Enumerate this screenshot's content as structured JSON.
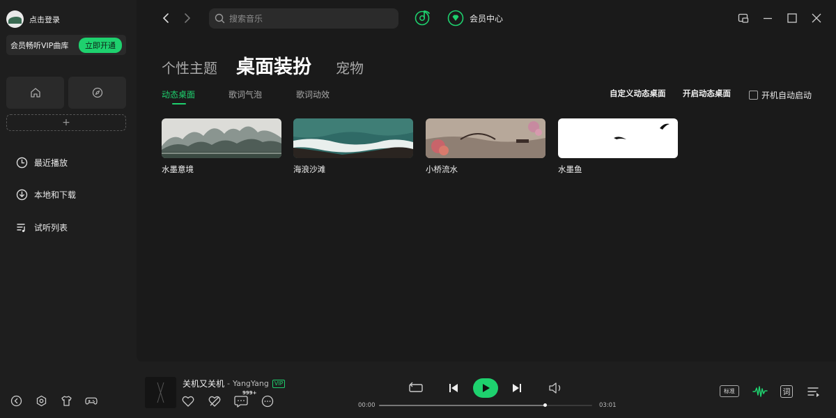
{
  "sidebar": {
    "login_text": "点击登录",
    "vip_text": "会员畅听VIP曲库",
    "vip_button": "立即开通",
    "add_label": "+",
    "nav": [
      {
        "label": "最近播放",
        "icon": "clock-icon"
      },
      {
        "label": "本地和下载",
        "icon": "download-icon"
      },
      {
        "label": "试听列表",
        "icon": "playlist-icon"
      }
    ],
    "bottom_icons": [
      "arrow-left-circle-icon",
      "settings-hex-icon",
      "tshirt-icon",
      "gamepad-icon"
    ]
  },
  "header": {
    "search_placeholder": "搜索音乐",
    "vip_center": "会员中心"
  },
  "tabs": {
    "main": [
      "个性主题",
      "桌面装扮",
      "宠物"
    ],
    "active_main": "桌面装扮",
    "sub": [
      "动态桌面",
      "歌词气泡",
      "歌词动效"
    ],
    "active_sub": "动态桌面"
  },
  "actions": {
    "custom": "自定义动态桌面",
    "enable": "开启动态桌面",
    "autostart": "开机自动启动"
  },
  "cards": [
    {
      "title": "水墨意境"
    },
    {
      "title": "海浪沙滩"
    },
    {
      "title": "小桥流水"
    },
    {
      "title": "水墨鱼"
    }
  ],
  "player": {
    "title": "关机又关机",
    "separator": "-",
    "artist": "YangYang",
    "vip_tag": "VIP",
    "comment_count": "999+",
    "time_current": "00:00",
    "time_total": "03:01",
    "progress": 0.78,
    "quality": "标准",
    "lyric": "词"
  },
  "colors": {
    "accent": "#1ed16e",
    "background": "#1a1a1a",
    "sidebar": "#1e1e1e"
  }
}
